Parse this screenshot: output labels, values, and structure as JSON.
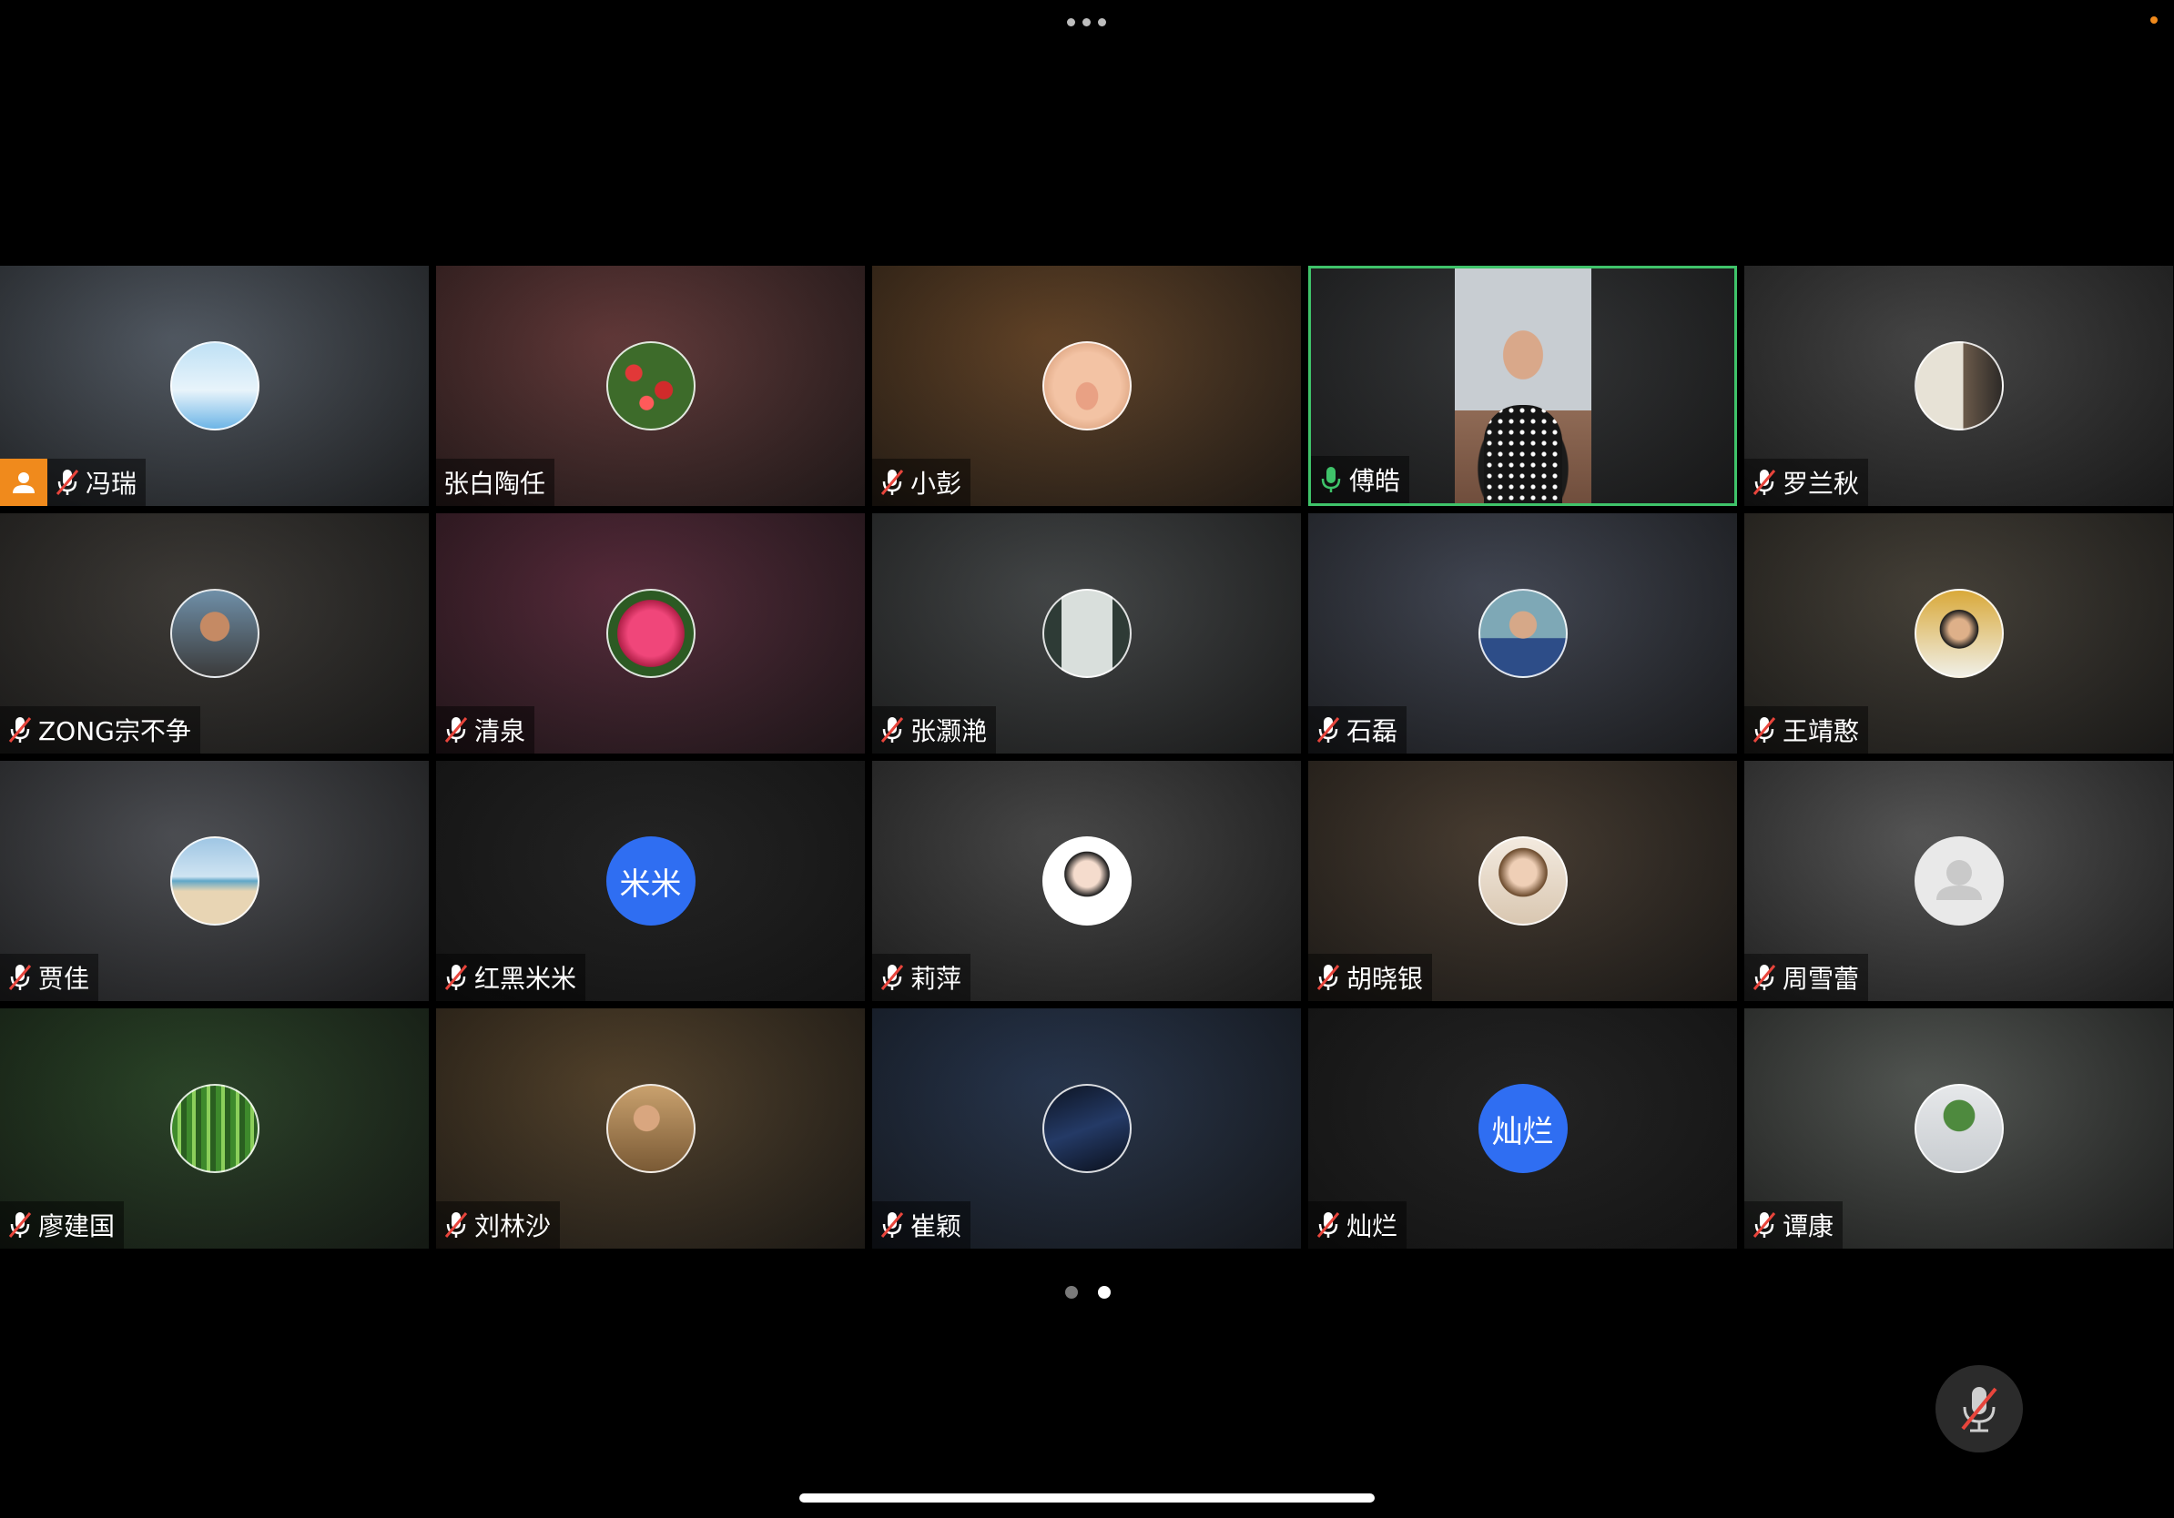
{
  "colors": {
    "accent_host": "#f08a1c",
    "speaking_border": "#3fc36a",
    "mic_active": "#3fc36a",
    "mic_muted_slash": "#e8453c",
    "initials_avatar_bg": "#2f6ef2"
  },
  "participants": [
    {
      "name": "冯瑞",
      "mic": "muted",
      "host": true,
      "avatar": "sky-photo",
      "bg": "#4a525c"
    },
    {
      "name": "张白陶任",
      "mic": "none",
      "avatar": "flowers-photo",
      "bg": "#5b2f2f"
    },
    {
      "name": "小彭",
      "mic": "muted",
      "avatar": "piglet-photo",
      "bg": "#5b3a1c"
    },
    {
      "name": "傅皓",
      "mic": "active",
      "speaking": true,
      "avatar": "live-video",
      "bg": "#2a2c2e"
    },
    {
      "name": "罗兰秋",
      "mic": "muted",
      "avatar": "calligraphy-photo",
      "bg": "#3c3c3c"
    },
    {
      "name": "ZONG宗不争",
      "mic": "muted",
      "avatar": "man-sunglasses-photo",
      "bg": "#33302c"
    },
    {
      "name": "清泉",
      "mic": "muted",
      "avatar": "pink-flower-photo",
      "bg": "#4e1f30"
    },
    {
      "name": "张灏滟",
      "mic": "muted",
      "avatar": "window-photo",
      "bg": "#3a3d3e"
    },
    {
      "name": "石磊",
      "mic": "muted",
      "avatar": "man-portrait-photo",
      "bg": "#383d4a"
    },
    {
      "name": "王靖憨",
      "mic": "muted",
      "avatar": "woman-autumn-photo",
      "bg": "#3b362d"
    },
    {
      "name": "贾佳",
      "mic": "muted",
      "avatar": "beach-photo",
      "bg": "#44464b"
    },
    {
      "name": "红黑米米",
      "mic": "muted",
      "avatar": "initials",
      "initials": "米米",
      "bg": "#161616"
    },
    {
      "name": "莉萍",
      "mic": "muted",
      "avatar": "cartoon-girl",
      "bg": "#3e3e3e"
    },
    {
      "name": "胡晓银",
      "mic": "muted",
      "avatar": "woman-portrait-photo",
      "bg": "#3e3226"
    },
    {
      "name": "周雪蕾",
      "mic": "muted",
      "avatar": "default-user",
      "bg": "#4e4e4e"
    },
    {
      "name": "廖建国",
      "mic": "muted",
      "avatar": "bamboo-photo",
      "bg": "#1f3a1c"
    },
    {
      "name": "刘林沙",
      "mic": "muted",
      "avatar": "man-reading-photo",
      "bg": "#4a3820"
    },
    {
      "name": "崔颖",
      "mic": "muted",
      "avatar": "night-sky-photo",
      "bg": "#1c2b44"
    },
    {
      "name": "灿烂",
      "mic": "muted",
      "avatar": "initials",
      "initials": "灿烂",
      "bg": "#161616"
    },
    {
      "name": "谭康",
      "mic": "muted",
      "avatar": "snow-plant-photo",
      "bg": "#4a4e4a"
    }
  ],
  "pager": {
    "pages": 2,
    "current": 2
  },
  "controls": {
    "mute_button": "microphone-muted-icon"
  }
}
